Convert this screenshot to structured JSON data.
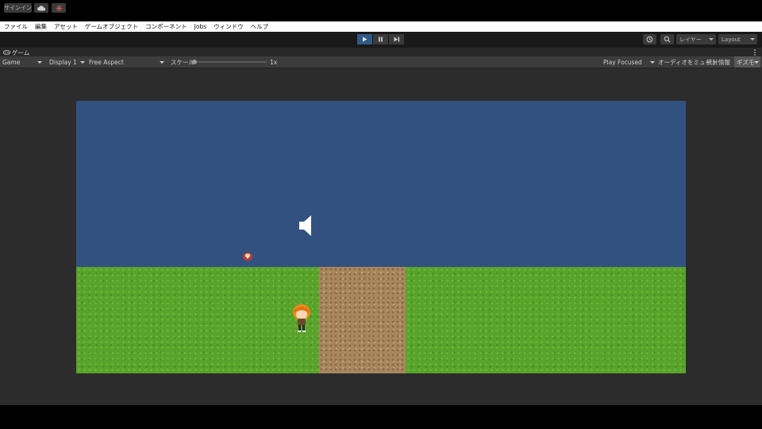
{
  "menu": [
    "ファイル",
    "編集",
    "アセット",
    "ゲームオブジェクト",
    "コンポーネント",
    "Jobs",
    "ウィンドウ",
    "ヘルプ"
  ],
  "toolbar": {
    "signin_label": "サインイン",
    "layers_label": "レイヤー",
    "layout_label": "Layout"
  },
  "game_tab": {
    "title": "ゲーム"
  },
  "game_bar": {
    "mode": "Game",
    "display": "Display 1",
    "aspect": "Free Aspect",
    "scale_label": "スケール",
    "scale_value": "1x",
    "scale_fraction": 0,
    "play_focused": "Play Focused",
    "mute_audio": "オーディオをミュート",
    "stats": "統計情報",
    "gizmos": "ギズモ"
  },
  "colors": {
    "sky": "#325180",
    "grass": "#59a32c",
    "dirt": "#a8875e",
    "play_active": "#2f5a86"
  }
}
